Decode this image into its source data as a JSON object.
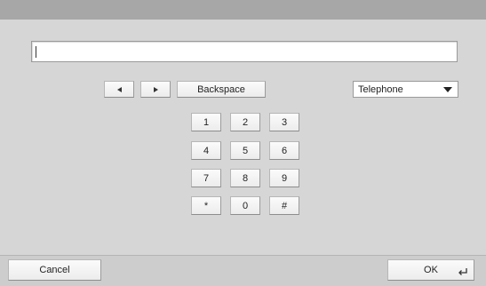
{
  "input": {
    "value": ""
  },
  "nav": {
    "left_icon": "arrow-left-icon",
    "right_icon": "arrow-right-icon",
    "backspace_label": "Backspace"
  },
  "mode_select": {
    "value": "Telephone",
    "icon": "chevron-down-icon"
  },
  "keypad": {
    "k1": "1",
    "k2": "2",
    "k3": "3",
    "k4": "4",
    "k5": "5",
    "k6": "6",
    "k7": "7",
    "k8": "8",
    "k9": "9",
    "kstar": "*",
    "k0": "0",
    "khash": "#"
  },
  "footer": {
    "cancel_label": "Cancel",
    "ok_label": "OK",
    "ok_icon": "enter-icon"
  }
}
